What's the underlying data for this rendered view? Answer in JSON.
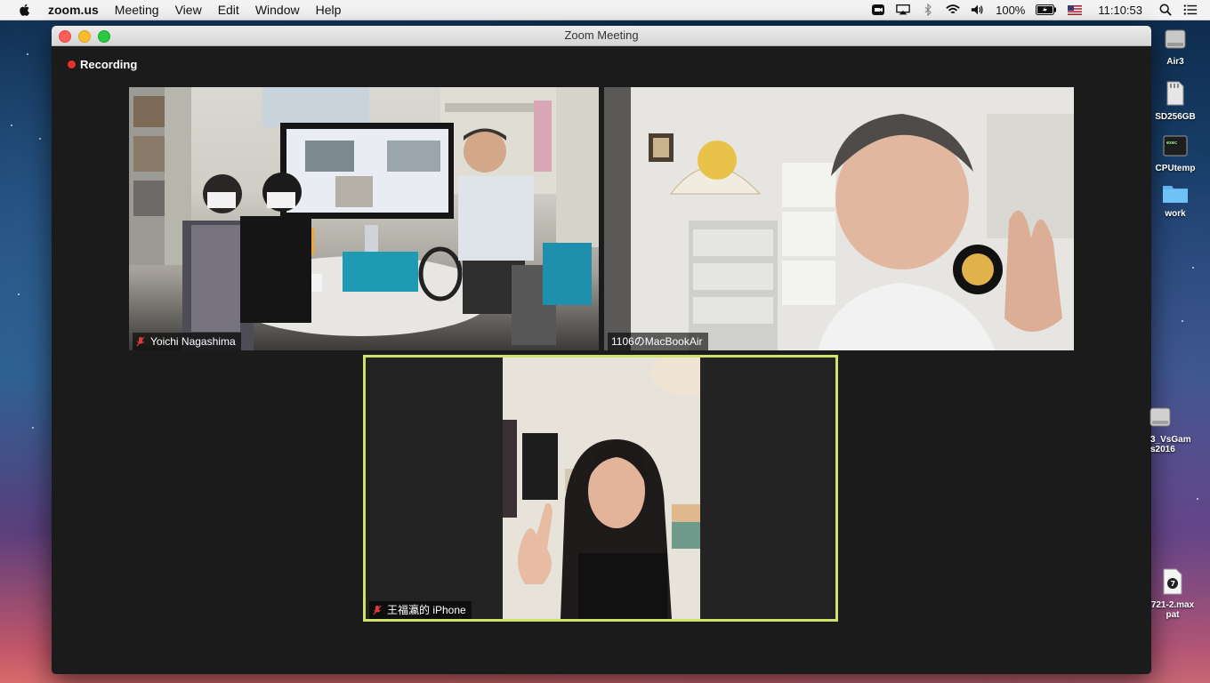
{
  "menubar": {
    "app_name": "zoom.us",
    "menus": [
      "Meeting",
      "View",
      "Edit",
      "Window",
      "Help"
    ],
    "battery": "100%",
    "clock": "11:10:53"
  },
  "window": {
    "title": "Zoom Meeting",
    "recording_label": "Recording"
  },
  "participants": [
    {
      "name": "Yoichi Nagashima",
      "muted": true
    },
    {
      "name": "1106のMacBookAir",
      "muted": false
    },
    {
      "name": "王福瀛的 iPhone",
      "muted": true,
      "active_speaker": true
    }
  ],
  "desktop_icons": [
    {
      "label": "Air3",
      "icon": "disk-icon"
    },
    {
      "label": "SD256GB",
      "icon": "sd-card-icon"
    },
    {
      "label": "CPUtemp",
      "icon": "terminal-icon"
    },
    {
      "label": "work",
      "icon": "folder-icon"
    },
    {
      "label": "3_VsGam\ns2016",
      "icon": "disk-icon"
    },
    {
      "label": "721-2.max\npat",
      "icon": "document-icon"
    }
  ],
  "colors": {
    "active_speaker_border": "#cfe36a",
    "recording_dot": "#e8302f"
  }
}
